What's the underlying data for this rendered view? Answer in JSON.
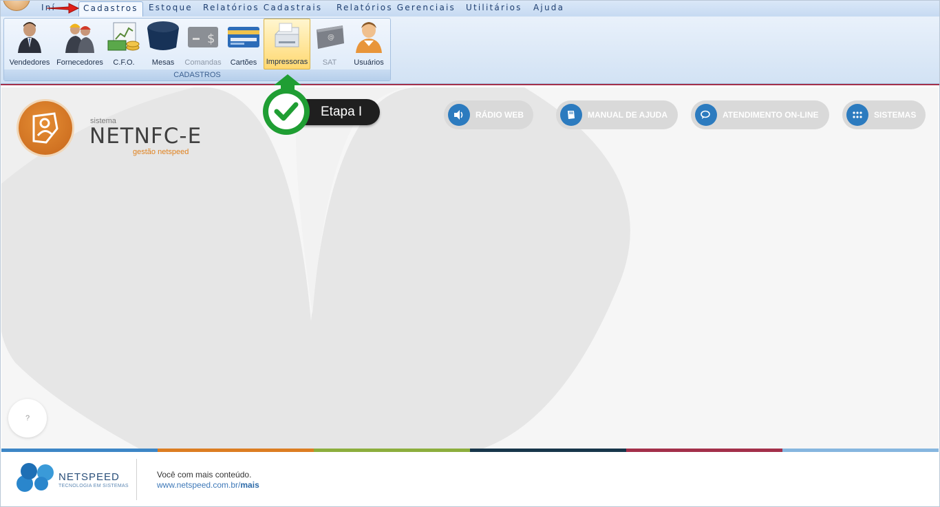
{
  "menu": {
    "items": [
      "Início",
      "Cadastros",
      "Estoque",
      "Relatórios",
      "Cadastrais",
      "Relatórios",
      "Gerenciais",
      "Utilitários",
      "Ajuda"
    ],
    "inicio": "Iní",
    "cadastros": "Cadastros",
    "estoque": "Estoque",
    "relatorios_cadastrais": "Relatórios Cadastrais",
    "relatorios_gerenciais": "Relatórios Gerenciais",
    "utilitarios": "Utilitários",
    "ajuda": "Ajuda",
    "active": "Cadastros"
  },
  "ribbon": {
    "group_caption": "CADASTROS",
    "buttons": [
      {
        "label": "Vendedores",
        "icon": "businessman-icon",
        "enabled": true
      },
      {
        "label": "Fornecedores",
        "icon": "workers-icon",
        "enabled": true
      },
      {
        "label": "C.F.O.",
        "icon": "chart-money-icon",
        "enabled": true
      },
      {
        "label": "Mesas",
        "icon": "table-icon",
        "enabled": true
      },
      {
        "label": "Comandas",
        "icon": "wallet-icon",
        "enabled": false
      },
      {
        "label": "Cartões",
        "icon": "credit-card-icon",
        "enabled": true
      },
      {
        "label": "Impressoras",
        "icon": "printer-icon",
        "enabled": true,
        "highlighted": true
      },
      {
        "label": "SAT",
        "icon": "sat-device-icon",
        "enabled": false
      },
      {
        "label": "Usuários",
        "icon": "user-icon",
        "enabled": true
      }
    ]
  },
  "brand": {
    "sistema": "sistema",
    "name": "NETNFC-E",
    "subtitle": "gestão netspeed"
  },
  "quick_buttons": {
    "radio": "RÁDIO WEB",
    "manual": "MANUAL DE AJUDA",
    "atendimento": "ATENDIMENTO ON-LINE",
    "sistemas": "SISTEMAS"
  },
  "callout": {
    "label": "Etapa I",
    "color": "#1f9e33"
  },
  "help": {
    "label": "?"
  },
  "footer": {
    "company": "NETSPEED",
    "tagline": "TECNOLOGIA EM SISTEMAS",
    "text1": "Você com mais conteúdo.",
    "url_prefix": "www.netspeed.com.br/",
    "url_suffix": "mais"
  },
  "colors": {
    "accent_red": "#a3304a",
    "brand_orange": "#d9781f",
    "button_blue": "#2c7bbf",
    "stripes": [
      "#3d86c6",
      "#dc7d22",
      "#8cae3d",
      "#17364a",
      "#a3304a",
      "#86b6df"
    ]
  }
}
